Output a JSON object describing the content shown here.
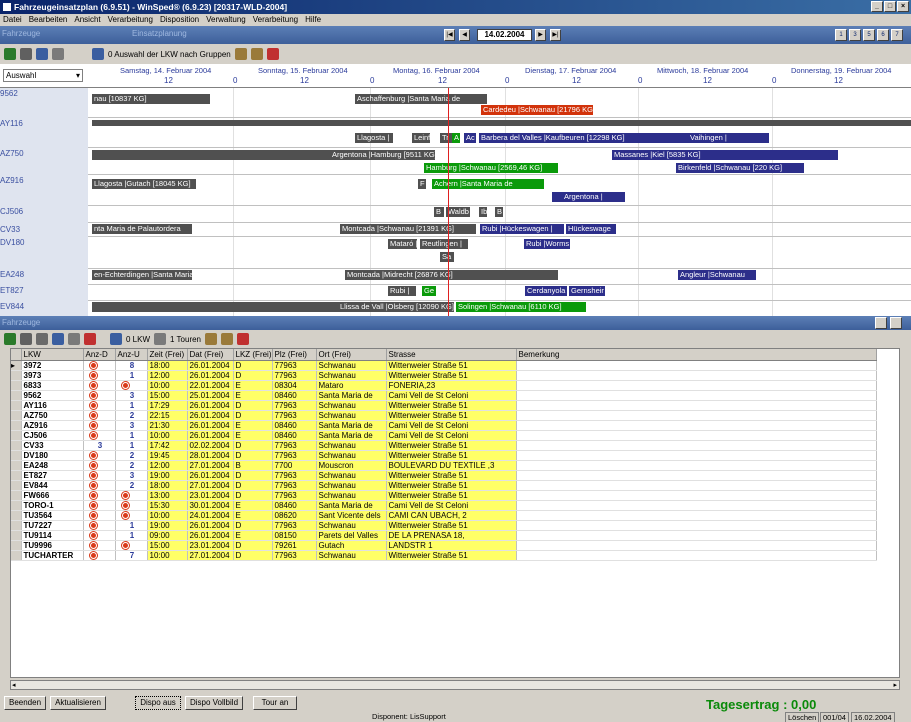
{
  "window": {
    "title": "Fahrzeugeinsatzplan (6.9.51) - WinSped® (6.9.23) [20317-WLD-2004]",
    "controls": [
      "_",
      "□",
      "×"
    ]
  },
  "menu": [
    "Datei",
    "Bearbeiten",
    "Ansicht",
    "Verarbeitung",
    "Disposition",
    "Verwaltung",
    "Verarbeitung",
    "Hilfe"
  ],
  "nav": {
    "left_label": "Fahrzeuge",
    "center_label": "Einsatzplanung",
    "date": "14.02.2004",
    "arrows": [
      "|◀",
      "◀",
      "▶",
      "▶|"
    ],
    "view_buttons": [
      "1",
      "3",
      "5",
      "6",
      "7"
    ]
  },
  "gantt_toolbar": {
    "group_label": "0 Auswahl der LKW nach Gruppen"
  },
  "gantt": {
    "selector": "Auswahl",
    "days": [
      {
        "label": "Samstag, 14. Februar 2004",
        "mid": "12",
        "end": "0"
      },
      {
        "label": "Sonntag, 15. Februar 2004",
        "mid": "12",
        "end": "0"
      },
      {
        "label": "Montag, 16. Februar 2004",
        "mid": "12",
        "end": "0"
      },
      {
        "label": "Dienstag, 17. Februar 2004",
        "mid": "12",
        "end": "0"
      },
      {
        "label": "Mittwoch, 18. Februar 2004",
        "mid": "12",
        "end": "0"
      },
      {
        "label": "Donnerstag, 19. Februar 2004",
        "mid": "12",
        "end": ""
      }
    ],
    "vehicles": [
      "9562",
      "AY116",
      "AZ750",
      "AZ916",
      "CJ506",
      "CV33",
      "DV180",
      "EA248",
      "ET827",
      "EV844"
    ],
    "bars": [
      {
        "text": "nau [10837 KG]",
        "color": "dark"
      },
      {
        "text": "Aschaffenburg |Santa Maria de",
        "color": "dark"
      },
      {
        "text": "Cardedeu |Schwanau [21796 KG]",
        "color": "red"
      },
      {
        "text": "",
        "color": "dark"
      },
      {
        "text": "Llagosta |",
        "color": "dark"
      },
      {
        "text": "Leinf",
        "color": "dark"
      },
      {
        "text": "Tr",
        "color": "dark"
      },
      {
        "text": "A",
        "color": "green"
      },
      {
        "text": "Ac",
        "color": "blue"
      },
      {
        "text": "Barbera del Valles |Kaufbeuren [12298 KG]",
        "color": "blue"
      },
      {
        "text": "Vaihingen |",
        "color": "blue"
      },
      {
        "text": "",
        "color": "dark"
      },
      {
        "text": "Argentona |Hamburg [9511 KG]",
        "color": "dark"
      },
      {
        "text": "Massanes |Kiel [5835 KG]",
        "color": "blue"
      },
      {
        "text": "Hamburg |Schwanau [2569,46 KG]",
        "color": "green"
      },
      {
        "text": "Birkenfeld |Schwanau [220 KG]",
        "color": "blue"
      },
      {
        "text": "Llagosta |Gutach [18045 KG]",
        "color": "dark"
      },
      {
        "text": "F",
        "color": "dark"
      },
      {
        "text": "Achern |Santa Maria de",
        "color": "green"
      },
      {
        "text": "Argentona |",
        "color": "blue"
      },
      {
        "text": "B",
        "color": "dark"
      },
      {
        "text": "Waldb",
        "color": "dark"
      },
      {
        "text": "Ib",
        "color": "dark"
      },
      {
        "text": "B",
        "color": "dark"
      },
      {
        "text": "nta Maria de Palautordera",
        "color": "dark"
      },
      {
        "text": "Montcada |Schwanau [21391 KG]",
        "color": "dark"
      },
      {
        "text": "Rubi |Hückeswagen |",
        "color": "blue"
      },
      {
        "text": "Hückeswage",
        "color": "blue"
      },
      {
        "text": "Mataró |",
        "color": "dark"
      },
      {
        "text": "Reutlingen |",
        "color": "dark"
      },
      {
        "text": "Rubi |Worms",
        "color": "blue"
      },
      {
        "text": "Sa",
        "color": "dark"
      },
      {
        "text": "en-Echterdingen |Santa Maria",
        "color": "dark"
      },
      {
        "text": "Montcada |Midrecht [26876 KG]",
        "color": "dark"
      },
      {
        "text": "Angleur |Schwanau",
        "color": "blue"
      },
      {
        "text": "Rubi |",
        "color": "dark"
      },
      {
        "text": "Ge",
        "color": "green"
      },
      {
        "text": "Cerdanyola",
        "color": "blue"
      },
      {
        "text": "Gernsheir",
        "color": "blue"
      },
      {
        "text": "",
        "color": "dark"
      },
      {
        "text": "Llissa de Vall |Olsberg [12090 KG]",
        "color": "dark"
      },
      {
        "text": "Solingen |Schwanau [6110 KG]",
        "color": "green"
      }
    ]
  },
  "list_section": {
    "label": "Fahrzeuge"
  },
  "list_toolbar": {
    "lkw": "0 LKW",
    "touren": "1 Touren"
  },
  "table": {
    "columns": [
      "LKW",
      "Anz-D",
      "Anz-U",
      "Zeit (Frei)",
      "Dat (Frei)",
      "LKZ (Frei)",
      "Plz (Frei)",
      "Ort (Frei)",
      "Strasse",
      "Bemerkung"
    ],
    "rows": [
      {
        "lkw": "3972",
        "anzd": "dot",
        "anzu": "8",
        "zeit": "18:00",
        "dat": "26.01.2004",
        "lkz": "D",
        "plz": "77963",
        "ort": "Schwanau",
        "strasse": "Wittenweier Straße 51"
      },
      {
        "lkw": "3973",
        "anzd": "dot",
        "anzu": "1",
        "zeit": "12:00",
        "dat": "26.01.2004",
        "lkz": "D",
        "plz": "77963",
        "ort": "Schwanau",
        "strasse": "Wittenweier Straße 51"
      },
      {
        "lkw": "6833",
        "anzd": "dot",
        "anzu": "dot",
        "zeit": "10:00",
        "dat": "22.01.2004",
        "lkz": "E",
        "plz": "08304",
        "ort": "Mataro",
        "strasse": "FONERIA,23"
      },
      {
        "lkw": "9562",
        "anzd": "dot",
        "anzu": "3",
        "zeit": "15:00",
        "dat": "25.01.2004",
        "lkz": "E",
        "plz": "08460",
        "ort": "Santa Maria de",
        "strasse": "Cami Vell de St Celoni"
      },
      {
        "lkw": "AY116",
        "anzd": "dot",
        "anzu": "1",
        "zeit": "17:29",
        "dat": "26.01.2004",
        "lkz": "D",
        "plz": "77963",
        "ort": "Schwanau",
        "strasse": "Wittenweier Straße 51"
      },
      {
        "lkw": "AZ750",
        "anzd": "dot",
        "anzu": "2",
        "zeit": "22:15",
        "dat": "26.01.2004",
        "lkz": "D",
        "plz": "77963",
        "ort": "Schwanau",
        "strasse": "Wittenweier Straße 51"
      },
      {
        "lkw": "AZ916",
        "anzd": "dot",
        "anzu": "3",
        "zeit": "21:30",
        "dat": "26.01.2004",
        "lkz": "E",
        "plz": "08460",
        "ort": "Santa Maria de",
        "strasse": "Cami Vell de St Celoni"
      },
      {
        "lkw": "CJ506",
        "anzd": "dot",
        "anzu": "1",
        "zeit": "10:00",
        "dat": "26.01.2004",
        "lkz": "E",
        "plz": "08460",
        "ort": "Santa Maria de",
        "strasse": "Cami Vell de St Celoni"
      },
      {
        "lkw": "CV33",
        "anzd": "3",
        "anzu": "1",
        "zeit": "17:42",
        "dat": "02.02.2004",
        "lkz": "D",
        "plz": "77963",
        "ort": "Schwanau",
        "strasse": "Wittenweier Straße 51"
      },
      {
        "lkw": "DV180",
        "anzd": "dot",
        "anzu": "2",
        "zeit": "19:45",
        "dat": "28.01.2004",
        "lkz": "D",
        "plz": "77963",
        "ort": "Schwanau",
        "strasse": "Wittenweier Straße 51"
      },
      {
        "lkw": "EA248",
        "anzd": "dot",
        "anzu": "2",
        "zeit": "12:00",
        "dat": "27.01.2004",
        "lkz": "B",
        "plz": "7700",
        "ort": "Mouscron",
        "strasse": "BOULEVARD DU TEXTILE ,3"
      },
      {
        "lkw": "ET827",
        "anzd": "dot",
        "anzu": "3",
        "zeit": "19:00",
        "dat": "26.01.2004",
        "lkz": "D",
        "plz": "77963",
        "ort": "Schwanau",
        "strasse": "Wittenweier Straße 51"
      },
      {
        "lkw": "EV844",
        "anzd": "dot",
        "anzu": "2",
        "zeit": "18:00",
        "dat": "27.01.2004",
        "lkz": "D",
        "plz": "77963",
        "ort": "Schwanau",
        "strasse": "Wittenweier Straße 51"
      },
      {
        "lkw": "FW666",
        "anzd": "dot",
        "anzu": "dot",
        "zeit": "13:00",
        "dat": "23.01.2004",
        "lkz": "D",
        "plz": "77963",
        "ort": "Schwanau",
        "strasse": "Wittenweier Straße 51"
      },
      {
        "lkw": "TORO-1",
        "anzd": "dot",
        "anzu": "dot",
        "zeit": "15:30",
        "dat": "30.01.2004",
        "lkz": "E",
        "plz": "08460",
        "ort": "Santa Maria de",
        "strasse": "Cami Vell de St Celoni"
      },
      {
        "lkw": "TU3564",
        "anzd": "dot",
        "anzu": "dot",
        "zeit": "10:00",
        "dat": "24.01.2004",
        "lkz": "E",
        "plz": "08620",
        "ort": "Sant Vicente dels",
        "strasse": "CAMI CAN UBACH, 2"
      },
      {
        "lkw": "TU7227",
        "anzd": "dot",
        "anzu": "1",
        "zeit": "19:00",
        "dat": "26.01.2004",
        "lkz": "D",
        "plz": "77963",
        "ort": "Schwanau",
        "strasse": "Wittenweier Straße 51"
      },
      {
        "lkw": "TU9114",
        "anzd": "dot",
        "anzu": "1",
        "zeit": "09:00",
        "dat": "26.01.2004",
        "lkz": "E",
        "plz": "08150",
        "ort": "Parets del Valles",
        "strasse": "DE LA PRENASA 18,"
      },
      {
        "lkw": "TU9996",
        "anzd": "dot",
        "anzu": "dot",
        "zeit": "15:00",
        "dat": "23.01.2004",
        "lkz": "D",
        "plz": "79261",
        "ort": "Gutach",
        "strasse": "LANDSTR 1"
      },
      {
        "lkw": "TUCHARTER",
        "anzd": "dot",
        "anzu": "7",
        "zeit": "10:00",
        "dat": "27.01.2004",
        "lkz": "D",
        "plz": "77963",
        "ort": "Schwanau",
        "strasse": "Wittenweier Straße 51"
      }
    ]
  },
  "buttons": {
    "beenden": "Beenden",
    "aktualisieren": "Aktualisieren",
    "dispo_aus": "Dispo aus",
    "dispo_vollbild": "Dispo Vollbild",
    "tour_an": "Tour an"
  },
  "tagesertrag": "Tagesertrag : 0,00",
  "status": {
    "disponent": "Disponent: LisSupport",
    "loeschen": "Löschen",
    "pos": "001/04",
    "date": "16.02.2004"
  },
  "colors": {
    "dark": "#505050",
    "green": "#0a9a0a",
    "blue": "#2c2e8a",
    "red": "#d2330b",
    "yellow": "#ffff66",
    "accent": "#0a246a"
  }
}
